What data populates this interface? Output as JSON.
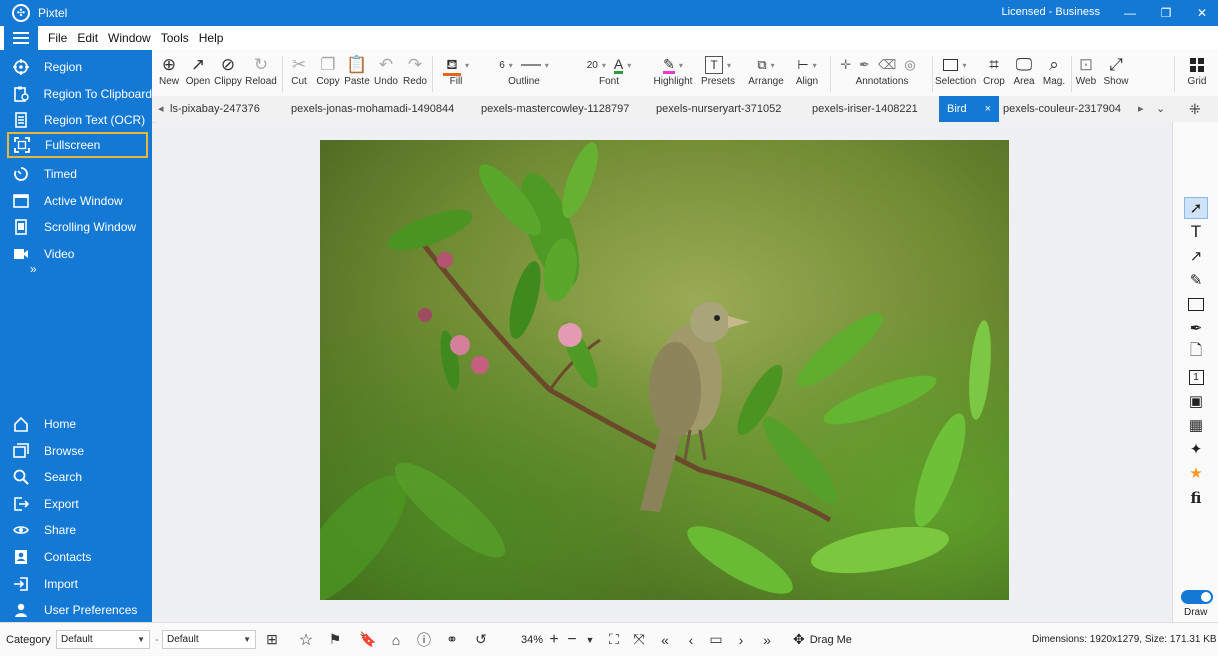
{
  "app": {
    "title": "Pixtel",
    "license": "Licensed - Business"
  },
  "menu": [
    "File",
    "Edit",
    "Window",
    "Tools",
    "Help"
  ],
  "sidebar": {
    "capture": [
      {
        "label": "Region",
        "icon": "crosshair-icon"
      },
      {
        "label": "Region To Clipboard",
        "icon": "clipboard-icon"
      },
      {
        "label": "Region Text (OCR)",
        "icon": "document-text-icon"
      },
      {
        "label": "Fullscreen",
        "icon": "fullscreen-icon"
      },
      {
        "label": "Timed",
        "icon": "timer-icon"
      },
      {
        "label": "Active Window",
        "icon": "window-icon"
      },
      {
        "label": "Scrolling Window",
        "icon": "scroll-icon"
      },
      {
        "label": "Video",
        "icon": "video-icon"
      }
    ],
    "expand": "»",
    "nav": [
      {
        "label": "Home",
        "icon": "home-icon"
      },
      {
        "label": "Browse",
        "icon": "browse-icon"
      },
      {
        "label": "Search",
        "icon": "search-icon"
      },
      {
        "label": "Export",
        "icon": "export-icon"
      },
      {
        "label": "Share",
        "icon": "share-icon"
      },
      {
        "label": "Contacts",
        "icon": "contacts-icon"
      },
      {
        "label": "Import",
        "icon": "import-icon"
      },
      {
        "label": "User Preferences",
        "icon": "user-icon"
      }
    ]
  },
  "toolbar": {
    "new": "New",
    "open": "Open",
    "clippy": "Clippy",
    "reload": "Reload",
    "cut": "Cut",
    "copy": "Copy",
    "paste": "Paste",
    "undo": "Undo",
    "redo": "Redo",
    "fill": "Fill",
    "outline_width": "6",
    "outline": "Outline",
    "font_size": "20",
    "font": "Font",
    "highlight": "Highlight",
    "presets": "Presets",
    "arrange": "Arrange",
    "align": "Align",
    "annotations": "Annotations",
    "selection": "Selection",
    "crop": "Crop",
    "area": "Area",
    "mag": "Mag.",
    "web": "Web",
    "show": "Show",
    "grid": "Grid",
    "fill_color": "#e8631e",
    "font_color": "#2e9a3e",
    "highlight_color": "#e63ad6"
  },
  "tabs": [
    {
      "label": "ls-pixabay-247376"
    },
    {
      "label": "pexels-jonas-mohamadi-1490844"
    },
    {
      "label": "pexels-mastercowley-1128797"
    },
    {
      "label": "pexels-nurseryart-371052"
    },
    {
      "label": "pexels-iriser-1408221"
    },
    {
      "label": "Bird",
      "active": true
    },
    {
      "label": "pexels-couleur-2317904"
    }
  ],
  "tab_close": "×",
  "tab_scroll_left": "◂",
  "tab_scroll_right": "▸",
  "tab_menu": "⌄",
  "draw": {
    "label": "Draw"
  },
  "status": {
    "category_label": "Category",
    "category_value": "Default",
    "preset_value": "Default",
    "zoom": "34%",
    "drag_me": "Drag Me",
    "info": "Dimensions: 1920x1279, Size: 171.31 KB"
  },
  "accent_color": "#1479d4",
  "highlight_border": "#e6b83b"
}
